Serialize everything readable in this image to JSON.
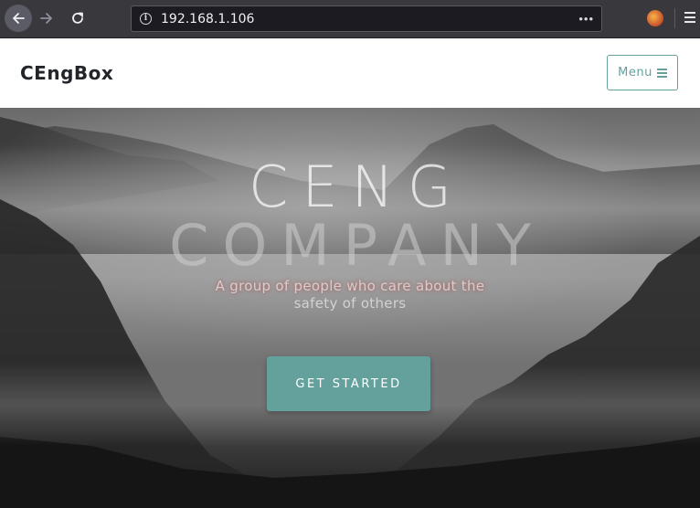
{
  "browser": {
    "url": "192.168.1.106",
    "more_glyph": "•••",
    "info_glyph": "i",
    "icons": [
      "back-arrow-icon",
      "forward-arrow-icon",
      "reload-icon",
      "info-icon",
      "page-actions-icon",
      "extension-icon",
      "hamburger-menu-icon"
    ]
  },
  "nav": {
    "brand": "CEngBox",
    "menu_label": "Menu"
  },
  "hero": {
    "title_line1": "CENG",
    "title_line2": "COMPANY",
    "subtitle_line1": "A group of people who care about the",
    "subtitle_line2": "safety of others",
    "cta_label": "GET STARTED"
  },
  "colors": {
    "accent": "#64a19d",
    "brand_text": "#212529",
    "chrome_bg": "#38383d"
  }
}
